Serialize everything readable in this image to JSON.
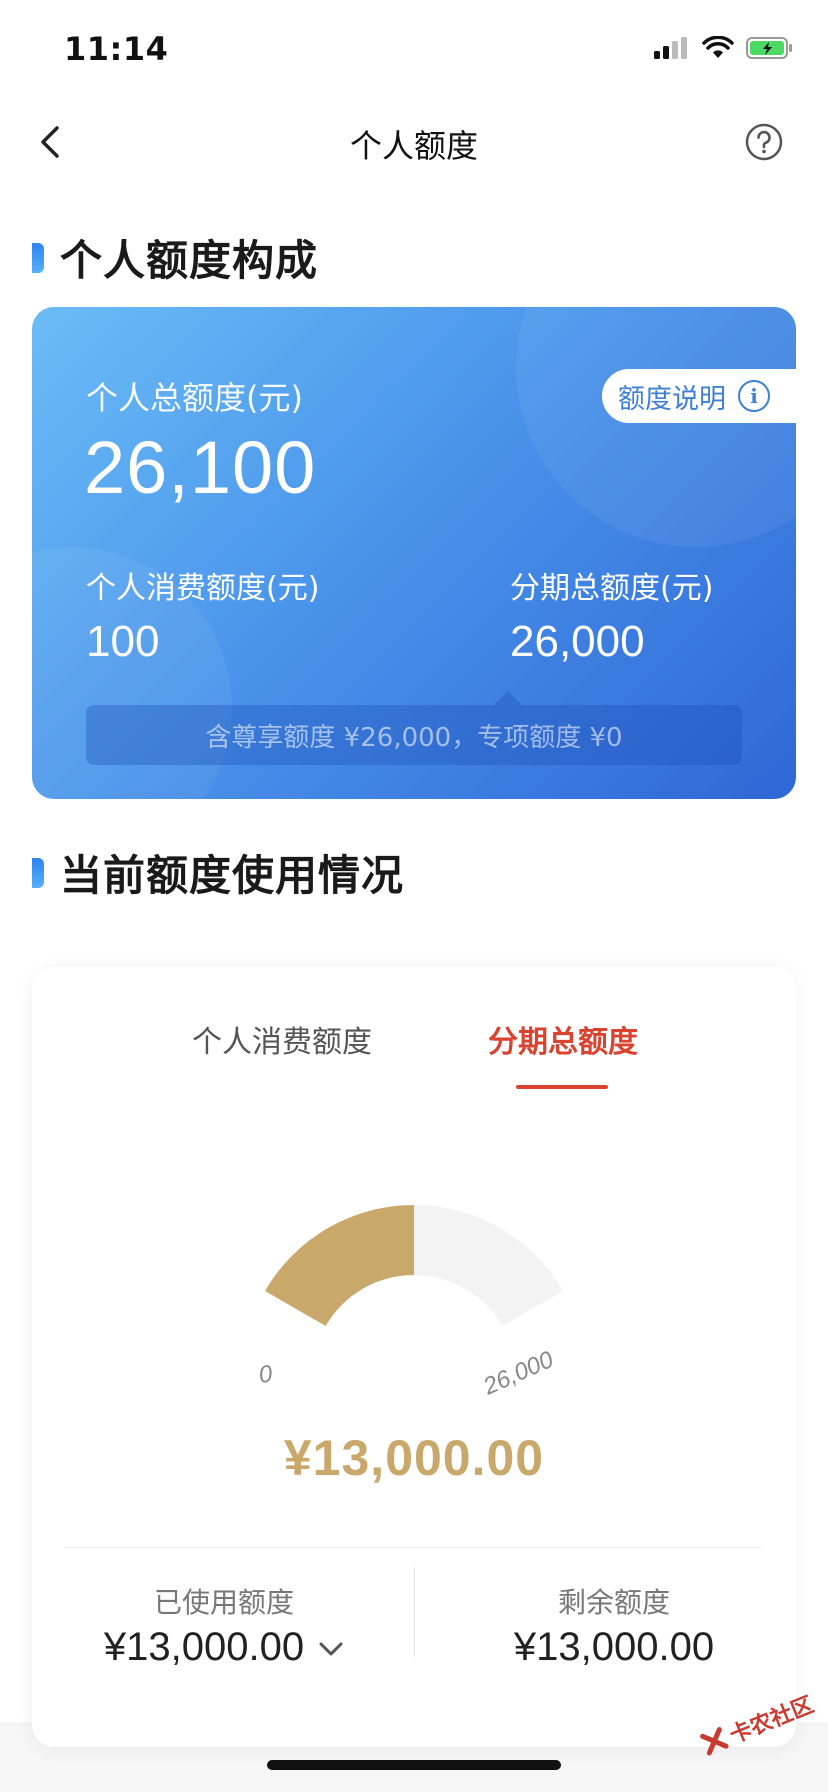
{
  "status": {
    "time": "11:14"
  },
  "nav": {
    "title": "个人额度"
  },
  "section1": {
    "title": "个人额度构成"
  },
  "card": {
    "total_label": "个人总额度(元)",
    "total_value": "26,100",
    "explain_label": "额度说明",
    "consume_label": "个人消费额度(元)",
    "consume_value": "100",
    "installment_label": "分期总额度(元)",
    "installment_value": "26,000",
    "tip": "含尊享额度 ¥26,000，专项额度 ¥0"
  },
  "section2": {
    "title": "当前额度使用情况"
  },
  "usage": {
    "tabs": [
      {
        "label": "个人消费额度",
        "active": false
      },
      {
        "label": "分期总额度",
        "active": true
      }
    ],
    "gauge_min": "0",
    "gauge_max": "26,000",
    "gauge_used_fraction": 0.5,
    "amount": "¥13,000.00",
    "used_label": "已使用额度",
    "used_value": "¥13,000.00",
    "remain_label": "剩余额度",
    "remain_value": "¥13,000.00"
  },
  "watermark": {
    "text": "卡农社区"
  },
  "colors": {
    "accent_red": "#d9432f",
    "gold": "#c9a86c",
    "gauge_bg": "#f3f3f3"
  }
}
